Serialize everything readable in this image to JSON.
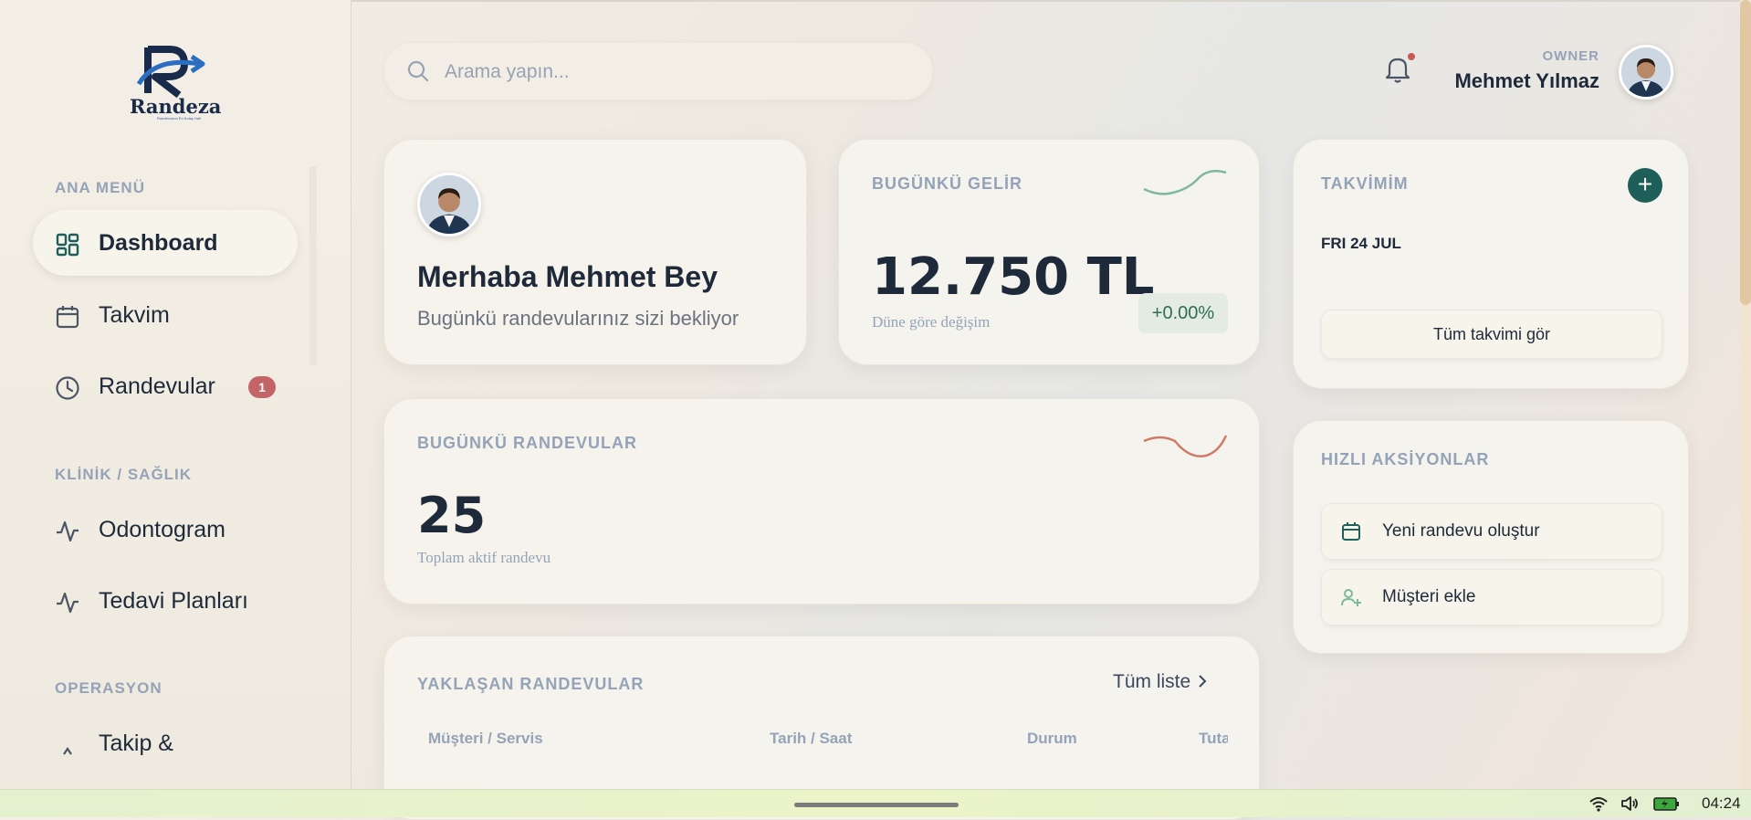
{
  "brand": {
    "name": "Randeza",
    "tagline": "Randevunun En Kolay Hali"
  },
  "sidebar": {
    "sections": [
      {
        "label": "ANA MENÜ"
      },
      {
        "label": "KLİNİK / SAĞLIK"
      },
      {
        "label": "OPERASYON"
      }
    ],
    "items": [
      {
        "label": "Dashboard",
        "icon": "dashboard-grid-icon",
        "active": true
      },
      {
        "label": "Takvim",
        "icon": "calendar-icon"
      },
      {
        "label": "Randevular",
        "icon": "clock-icon",
        "badge": "1"
      },
      {
        "label": "Odontogram",
        "icon": "pulse-icon"
      },
      {
        "label": "Tedavi Planları",
        "icon": "pulse-icon"
      },
      {
        "label": "Takip &",
        "icon": "chevron-up-icon"
      }
    ]
  },
  "header": {
    "search_placeholder": "Arama yapın...",
    "role": "OWNER",
    "user_name": "Mehmet Yılmaz"
  },
  "welcome": {
    "title": "Merhaba Mehmet Bey",
    "subtitle": "Bugünkü randevularınız sizi bekliyor"
  },
  "revenue": {
    "title": "BUGÜNKÜ GELİR",
    "value": "12.750 TL",
    "caption": "Düne göre değişim",
    "change": "+0.00%",
    "sparkline_color": "#7fb89a"
  },
  "appointments": {
    "title": "BUGÜNKÜ RANDEVULAR",
    "value": "25",
    "caption": "Toplam aktif randevu",
    "sparkline_color": "#d07a68"
  },
  "upcoming": {
    "title": "YAKLAŞAN RANDEVULAR",
    "link": "Tüm liste",
    "columns": [
      "Müşteri / Servis",
      "Tarih / Saat",
      "Durum",
      "Tuta"
    ]
  },
  "calendar": {
    "title": "TAKVİMİM",
    "date": "FRI 24 JUL",
    "button": "Tüm takvimi gör",
    "add": "+"
  },
  "quick_actions": {
    "title": "HIZLI AKSİYONLAR",
    "items": [
      {
        "label": "Yeni randevu oluştur",
        "icon": "calendar-icon"
      },
      {
        "label": "Müşteri ekle",
        "icon": "add-user-icon"
      }
    ]
  },
  "taskbar": {
    "time": "04:24"
  },
  "colors": {
    "accent": "#1e5f5a",
    "badge": "#c26468",
    "muted": "#94a3b8"
  }
}
